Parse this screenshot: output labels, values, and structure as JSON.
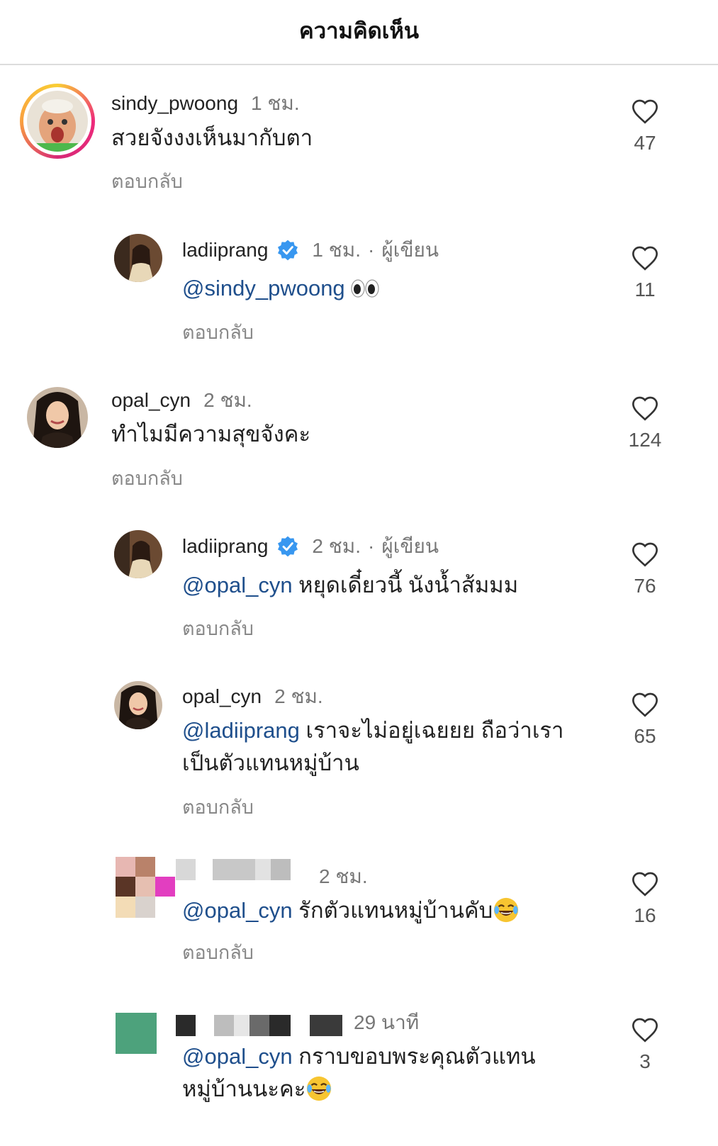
{
  "header": {
    "title": "ความคิดเห็น"
  },
  "comments": [
    {
      "username": "sindy_pwoong",
      "time": "1 ชม.",
      "text": "สวยจังงงเห็นมากับตา",
      "reply": "ตอบกลับ",
      "likes": "47"
    },
    {
      "username": "ladiiprang",
      "time": "1 ชม.",
      "author": "ผู้เขียน",
      "mention": "@sindy_pwoong",
      "text": "",
      "reply": "ตอบกลับ",
      "likes": "11"
    },
    {
      "username": "opal_cyn",
      "time": "2 ชม.",
      "text": "ทำไมมีความสุขจังคะ",
      "reply": "ตอบกลับ",
      "likes": "124"
    },
    {
      "username": "ladiiprang",
      "time": "2 ชม.",
      "author": "ผู้เขียน",
      "mention": "@opal_cyn",
      "text": " หยุดเดี๋ยวนี้ นังน้ำส้มมม",
      "reply": "ตอบกลับ",
      "likes": "76"
    },
    {
      "username": "opal_cyn",
      "time": "2 ชม.",
      "mention": "@ladiiprang",
      "text": " เราจะไม่อยู่เฉยยย ถือว่าเรา",
      "text2": "เป็นตัวแทนหมู่บ้าน",
      "reply": "ตอบกลับ",
      "likes": "65"
    },
    {
      "time": "2 ชม.",
      "mention": "@opal_cyn",
      "text": " รักตัวแทนหมู่บ้านคับ",
      "reply": "ตอบกลับ",
      "likes": "16"
    },
    {
      "time": "29 นาที",
      "mention": "@opal_cyn",
      "text": " กราบขอบพระคุณตัวแทน",
      "text2": "หมู่บ้านนะคะ",
      "likes": "3"
    }
  ]
}
